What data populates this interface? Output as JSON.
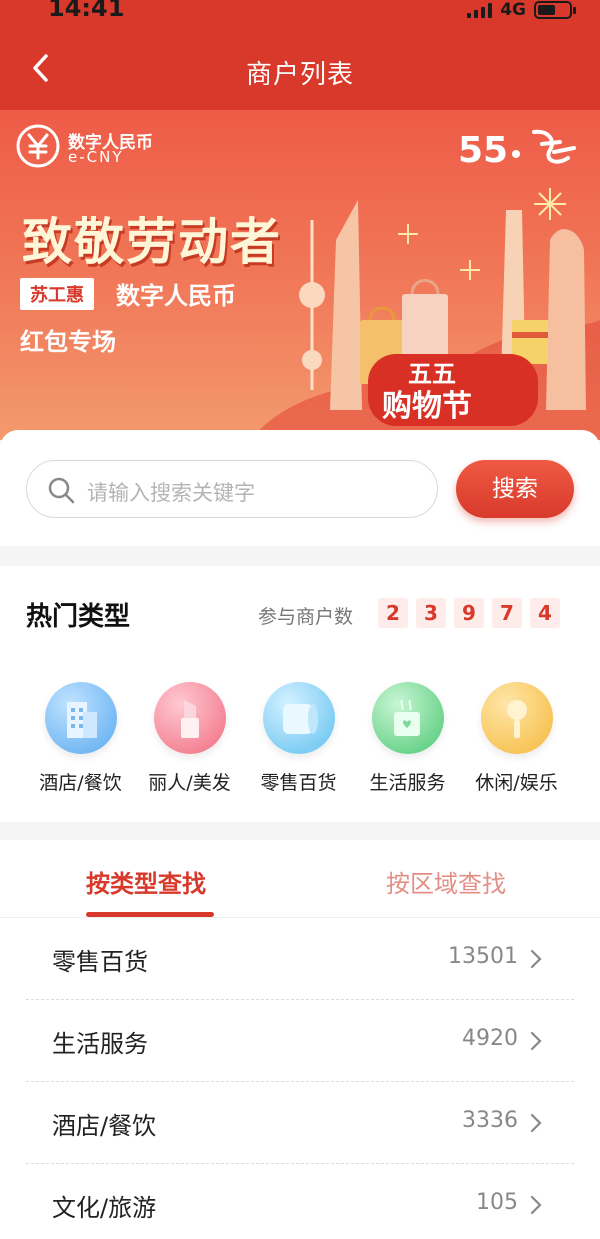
{
  "status_bar": {
    "time": "14:41",
    "network": "4G",
    "battery_level": 0.55
  },
  "nav": {
    "title": "商户列表",
    "back_icon": "chevron-left-icon"
  },
  "banner": {
    "logo_cn": "数字人民币",
    "logo_en": "e-CNY",
    "headline": "致敬劳动者",
    "tag": "苏工惠",
    "subtitle_1": "数字人民币",
    "subtitle_2": "红包专场",
    "festival_top": "五五",
    "festival_bottom": "购物节",
    "partner_mark": "55"
  },
  "search": {
    "placeholder": "请输入搜索关键字",
    "button_label": "搜索",
    "icon": "search-icon"
  },
  "hot": {
    "title": "热门类型",
    "merchant_count_label": "参与商户数",
    "merchant_count_digits": [
      "2",
      "3",
      "9",
      "7",
      "4"
    ],
    "categories": [
      {
        "label": "酒店/餐饮",
        "icon": "building-icon",
        "color": "#5aa9f0"
      },
      {
        "label": "丽人/美发",
        "icon": "lipstick-icon",
        "color": "#f06b80"
      },
      {
        "label": "零售百货",
        "icon": "towel-roll-icon",
        "color": "#5fc0f0"
      },
      {
        "label": "生活服务",
        "icon": "coffee-cup-icon",
        "color": "#4cc873"
      },
      {
        "label": "休闲/娱乐",
        "icon": "microphone-icon",
        "color": "#f5b83c"
      }
    ]
  },
  "tabs": {
    "active": "按类型查找",
    "inactive": "按区域查找"
  },
  "list": [
    {
      "name": "零售百货",
      "count": "13501"
    },
    {
      "name": "生活服务",
      "count": "4920"
    },
    {
      "name": "酒店/餐饮",
      "count": "3336"
    },
    {
      "name": "文化/旅游",
      "count": "105"
    }
  ],
  "colors": {
    "brand": "#d8392b",
    "tab_inactive": "#e38f86"
  }
}
